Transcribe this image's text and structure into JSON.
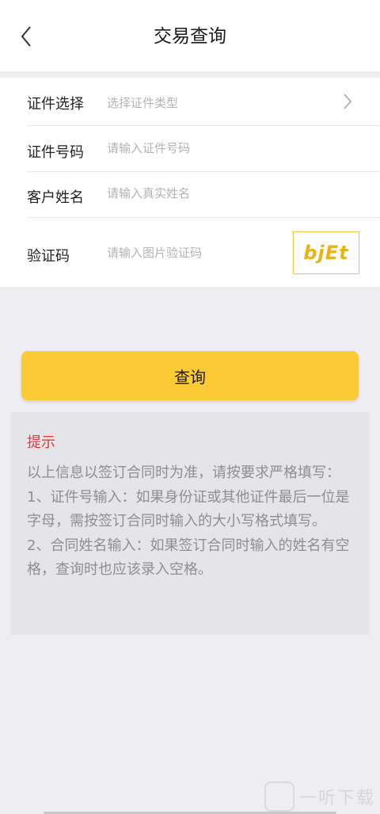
{
  "header": {
    "title": "交易查询",
    "back_icon": "chevron-left-icon"
  },
  "form": {
    "cert_type": {
      "label": "证件选择",
      "placeholder": "选择证件类型",
      "icon": "chevron-right-icon"
    },
    "cert_number": {
      "label": "证件号码",
      "placeholder": "请输入证件号码"
    },
    "customer_name": {
      "label": "客户姓名",
      "placeholder": "请输入真实姓名"
    },
    "captcha": {
      "label": "验证码",
      "placeholder": "请输入图片验证码",
      "image_text": "bjEt"
    }
  },
  "actions": {
    "query_label": "查询",
    "accent_color": "#fbca34"
  },
  "tips": {
    "title": "提示",
    "body": "以上信息以签订合同时为准，请按要求严格填写：\n1、证件号输入：如果身份证或其他证件最后一位是字母，需按签订合同时输入的大小写格式填写。\n2、合同姓名输入：如果签订合同时输入的姓名有空格，查询时也应该录入空格。",
    "title_color": "#e53935"
  },
  "watermark": {
    "text": "一听下载"
  }
}
